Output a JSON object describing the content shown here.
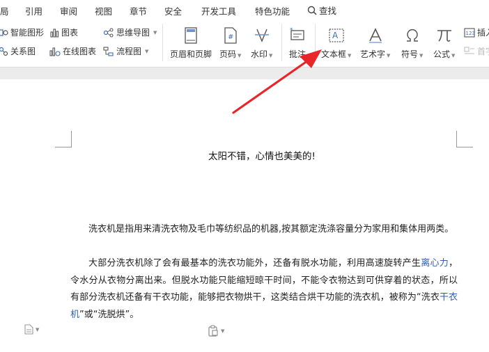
{
  "menu": {
    "items": [
      "局",
      "引用",
      "审阅",
      "视图",
      "章节",
      "安全",
      "开发工具",
      "特色功能"
    ],
    "search_label": "查找"
  },
  "ribbon": {
    "smart_shape": "智能图形",
    "chart": "图表",
    "mind_map": "思维导图",
    "relation_map": "关系图",
    "online_chart": "在线图表",
    "flowchart": "流程图",
    "header_footer": "页眉和页脚",
    "page_number": "页码",
    "watermark": "水印",
    "comment": "批注",
    "textbox": "文本框",
    "art_text": "艺术字",
    "symbol": "符号",
    "formula": "公式",
    "insert_more": "插入",
    "first_char": "首字"
  },
  "document": {
    "header_text": "太阳不错，心情也美美的!",
    "para1": "洗衣机是指用来清洗衣物及毛巾等纺织品的机器,按其额定洗涤容量分为家用和集体用两类。",
    "para2_a": "大部分洗衣机除了会有最基本的洗衣功能外，还备有脱水功能，利用高速旋转产生",
    "para2_link": "离心力",
    "para2_b": "，令水分从衣物分离出来。但脱水功能只能缩短晾干时间，不能令衣物达到可供穿着的状态，所以有部分洗衣机还备有干衣功能，能够把衣物烘干，这类结合烘干功能的洗衣机，被称为“洗衣",
    "para2_link2": "干衣机",
    "para2_c": "”或“洗脱烘”。"
  },
  "colors": {
    "arrow": "#e8262a",
    "link": "#2e5fb0"
  }
}
